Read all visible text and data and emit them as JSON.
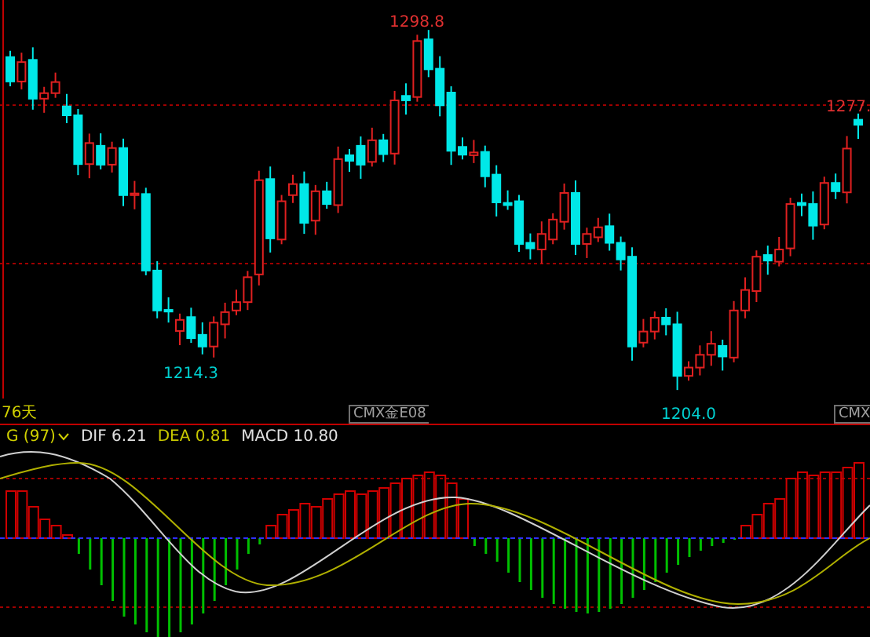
{
  "price_chart": {
    "high_label": "1298.8",
    "last_label": "1277.",
    "low_label": "1214.3",
    "second_low_label": "1204.0"
  },
  "footer": {
    "period": "76天",
    "contract_labels": [
      "CMX金E08",
      "CMX"
    ]
  },
  "macd": {
    "indicator": "G (97)",
    "dif": "DIF 6.21",
    "dea": "DEA 0.81",
    "macd": "MACD 10.80"
  }
}
